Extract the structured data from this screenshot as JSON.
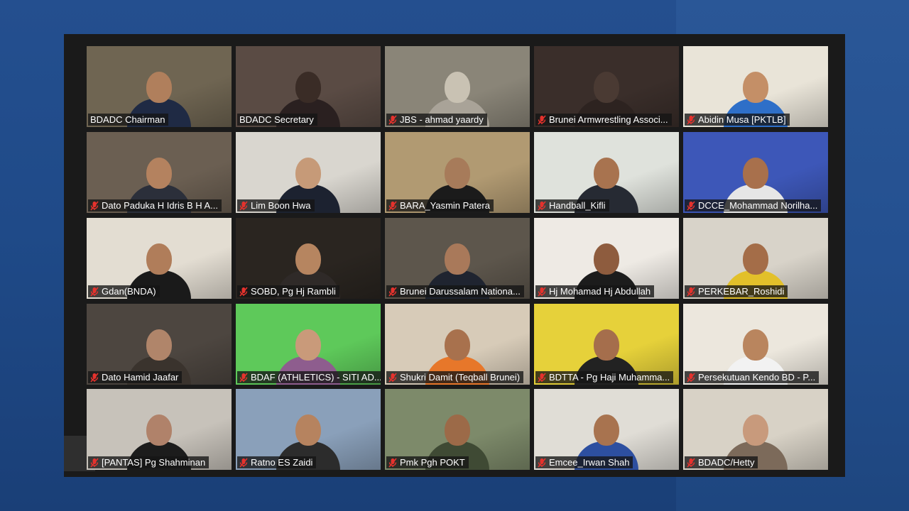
{
  "meeting": {
    "participants": [
      {
        "name": "BDADC Chairman",
        "muted": false,
        "active": true,
        "bg": "#6f6552",
        "skin": "#b07f5c",
        "shirt": "#1f2a44"
      },
      {
        "name": "BDADC Secretary",
        "muted": false,
        "active": false,
        "bg": "#5a4b44",
        "skin": "#3a2c26",
        "shirt": "#2a2020"
      },
      {
        "name": "JBS - ahmad yaardy",
        "muted": true,
        "active": false,
        "bg": "#8a8578",
        "skin": "#c9c2b3",
        "shirt": "#a9a398"
      },
      {
        "name": "Brunei Armwrestling Associ...",
        "muted": true,
        "active": false,
        "bg": "#3a2e2a",
        "skin": "#4a3a33",
        "shirt": "#2d2320"
      },
      {
        "name": "Abidin Musa [PKTLB]",
        "muted": true,
        "active": false,
        "bg": "#e9e4d8",
        "skin": "#c48f67",
        "shirt": "#2e6fc8"
      },
      {
        "name": "Dato Paduka H Idris B H A...",
        "muted": true,
        "active": false,
        "bg": "#6b5f52",
        "skin": "#b4825f",
        "shirt": "#2b2f3a"
      },
      {
        "name": "Lim Boon Hwa",
        "muted": true,
        "active": false,
        "bg": "#d9d6cf",
        "skin": "#c69a78",
        "shirt": "#1c2230"
      },
      {
        "name": "BARA_Yasmin Patera",
        "muted": true,
        "active": false,
        "bg": "#b19a72",
        "skin": "#a77b5a",
        "shirt": "#1b1b1b"
      },
      {
        "name": "Handball_Kifli",
        "muted": true,
        "active": false,
        "bg": "#dfe2dc",
        "skin": "#a8734f",
        "shirt": "#262a33"
      },
      {
        "name": "DCCE_Mohammad Norilha...",
        "muted": true,
        "active": false,
        "bg": "#3d57b8",
        "skin": "#a8704c",
        "shirt": "#e6e6e6"
      },
      {
        "name": "Gdan(BNDA)",
        "muted": true,
        "active": false,
        "bg": "#e3ddd2",
        "skin": "#b07d5a",
        "shirt": "#1a1a1a"
      },
      {
        "name": "SOBD, Pg Hj Rambli",
        "muted": true,
        "active": false,
        "bg": "#2a2520",
        "skin": "#b68560",
        "shirt": "#2f2a28"
      },
      {
        "name": "Brunei Darussalam Nationa...",
        "muted": true,
        "active": false,
        "bg": "#5d564c",
        "skin": "#a9795a",
        "shirt": "#1f2430"
      },
      {
        "name": "Hj Mohamad Hj Abdullah",
        "muted": true,
        "active": false,
        "bg": "#eeeae4",
        "skin": "#8e5c3e",
        "shirt": "#1c1c1c"
      },
      {
        "name": "PERKEBAR_Roshidi",
        "muted": true,
        "active": false,
        "bg": "#d8d3c9",
        "skin": "#a46d48",
        "shirt": "#e2c02a"
      },
      {
        "name": "Dato Hamid Jaafar",
        "muted": true,
        "active": false,
        "bg": "#4d4640",
        "skin": "#b0856a",
        "shirt": "#3a332d"
      },
      {
        "name": "BDAF (ATHLETICS) - SITI AD...",
        "muted": true,
        "active": false,
        "bg": "#5ec95a",
        "skin": "#c99a7a",
        "shirt": "#8e5d8e"
      },
      {
        "name": "Shukri Damit (Teqball Brunei)",
        "muted": true,
        "active": false,
        "bg": "#d7cbb8",
        "skin": "#a8714d",
        "shirt": "#e7772a"
      },
      {
        "name": "BDTTA - Pg Haji Muhamma...",
        "muted": true,
        "active": false,
        "bg": "#e6d13a",
        "skin": "#a56e4c",
        "shirt": "#222222"
      },
      {
        "name": "Persekutuan Kendo BD - P...",
        "muted": true,
        "active": false,
        "bg": "#ece7dd",
        "skin": "#b9855e",
        "shirt": "#f2f2f2"
      },
      {
        "name": "[PANTAS] Pg Shahminan",
        "muted": true,
        "active": false,
        "bg": "#c7c2ba",
        "skin": "#b0826a",
        "shirt": "#1c1c1c"
      },
      {
        "name": "Ratno ES Zaidi",
        "muted": true,
        "active": false,
        "bg": "#8aa0ba",
        "skin": "#b6835f",
        "shirt": "#2c2c2c"
      },
      {
        "name": "Pmk Pgh POKT",
        "muted": true,
        "active": false,
        "bg": "#7d8a6a",
        "skin": "#9c6a48",
        "shirt": "#3f4a34"
      },
      {
        "name": "Emcee_Irwan Shah",
        "muted": true,
        "active": false,
        "bg": "#e0ddd6",
        "skin": "#a8734f",
        "shirt": "#2d4fa0"
      },
      {
        "name": "BDADC/Hetty",
        "muted": true,
        "active": false,
        "bg": "#d8d2c6",
        "skin": "#c89a7c",
        "shirt": "#7c6a5a"
      }
    ]
  },
  "colors": {
    "active_speaker_border": "#c5e35a",
    "mute_icon": "#e5322d",
    "name_text": "#ffffff"
  }
}
